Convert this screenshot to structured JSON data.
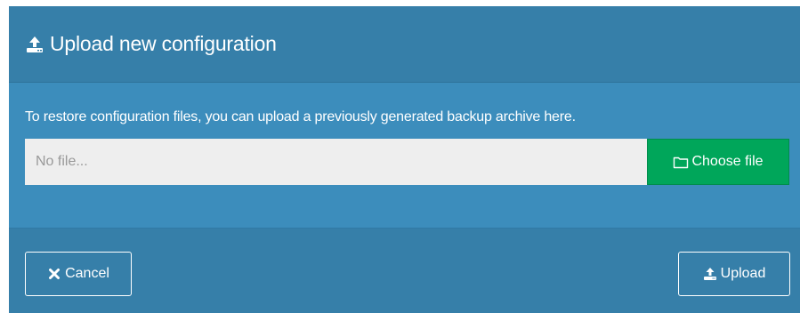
{
  "modal": {
    "title": "Upload new configuration",
    "title_icon": "upload-icon",
    "body_text": "To restore configuration files, you can upload a previously generated backup archive here.",
    "file_input": {
      "value": "",
      "placeholder": "No file..."
    },
    "choose_button": {
      "label": "Choose file",
      "icon": "folder-open-icon"
    },
    "cancel_button": {
      "label": "Cancel",
      "icon": "close-icon"
    },
    "upload_button": {
      "label": "Upload",
      "icon": "upload-icon"
    }
  },
  "colors": {
    "modal_body": "#3c8dbc",
    "modal_header_footer": "#367fa9",
    "choose_button": "#00a65a",
    "file_input_bg": "#eeeeee",
    "text": "#ffffff"
  }
}
